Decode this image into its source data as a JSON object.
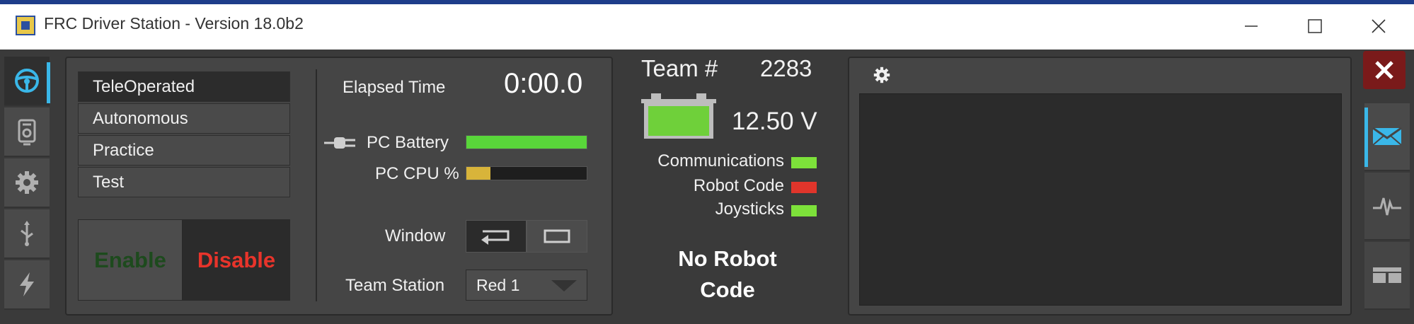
{
  "window": {
    "title": "FRC Driver Station - Version 18.0b2"
  },
  "left_nav": {
    "items": [
      {
        "icon": "steering-wheel-icon",
        "active": true
      },
      {
        "icon": "diagnostics-icon",
        "active": false
      },
      {
        "icon": "gear-icon",
        "active": false
      },
      {
        "icon": "usb-icon",
        "active": false
      },
      {
        "icon": "lightning-icon",
        "active": false
      }
    ]
  },
  "modes": {
    "items": [
      "TeleOperated",
      "Autonomous",
      "Practice",
      "Test"
    ],
    "selected": "TeleOperated"
  },
  "controls": {
    "enable_label": "Enable",
    "disable_label": "Disable"
  },
  "stats": {
    "elapsed_label": "Elapsed Time",
    "elapsed_value": "0:00.0",
    "pc_battery_label": "PC Battery",
    "pc_battery_level": 1.0,
    "pc_cpu_label": "PC CPU %",
    "pc_cpu_level": 0.2,
    "window_label": "Window",
    "team_station_label": "Team Station",
    "team_station_value": "Red 1"
  },
  "status": {
    "team_label": "Team #",
    "team_number": "2283",
    "voltage": "12.50 V",
    "communications_label": "Communications",
    "robot_code_label": "Robot Code",
    "joysticks_label": "Joysticks",
    "no_robot_code_line1": "No Robot",
    "no_robot_code_line2": "Code"
  },
  "colors": {
    "accent": "#3ab7e8",
    "ok": "#7de13a",
    "error": "#e0352b",
    "cpu": "#d8b43a",
    "battery_bar": "#59d63a"
  },
  "right_nav": {
    "items": [
      {
        "icon": "close-icon"
      },
      {
        "icon": "envelope-icon",
        "active": true
      },
      {
        "icon": "waveform-icon"
      },
      {
        "icon": "layout-icon"
      }
    ]
  }
}
